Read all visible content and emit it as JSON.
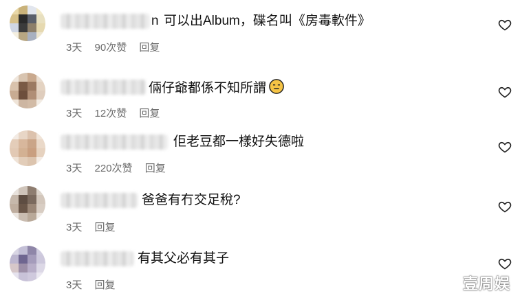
{
  "comments": [
    {
      "name_visible_fragment": "n",
      "text": "可以出Album，碟名叫《房毒軟件》",
      "time": "3天",
      "likes": "90次赞",
      "reply": "回复",
      "avatar_colors": [
        "#e9d8a8",
        "#c9b27a",
        "#e2e6ee",
        "#f2e9c8",
        "#d6c089",
        "#2a2a2a",
        "#5a5f6a",
        "#e8e0c0",
        "#cfd6e4",
        "#3b3b3b",
        "#8d7f6a",
        "#e6d9b0",
        "#f4efe0",
        "#b7a682",
        "#a8b0c0",
        "#eee6d0"
      ]
    },
    {
      "text": "倆仔爺都係不知所謂",
      "time": "3天",
      "likes": "12次赞",
      "reply": "回复",
      "avatar_colors": [
        "#efe6dc",
        "#d8c4b0",
        "#c9a98e",
        "#e9ddd0",
        "#d9c2ac",
        "#7a5a45",
        "#9c7a62",
        "#e4d3c2",
        "#c8ab92",
        "#6d4e3c",
        "#b08e76",
        "#dfcdbd",
        "#efe4d8",
        "#cdb6a2",
        "#d2bba6",
        "#f2ebe3"
      ]
    },
    {
      "text": "佢老豆都一樣好失德啦",
      "time": "3天",
      "likes": "220次赞",
      "reply": "回复",
      "avatar_colors": [
        "#f3ebe4",
        "#e8d6c6",
        "#dcc2ad",
        "#f0e4d8",
        "#e4cdb9",
        "#d8b79c",
        "#caa588",
        "#ead9c9",
        "#e2c9b4",
        "#d3b193",
        "#c99f80",
        "#e6d2bf",
        "#efe3d7",
        "#e2cdb9",
        "#dcc4ae",
        "#f4ece5"
      ]
    },
    {
      "text": "爸爸有冇交足稅?",
      "time": "3天",
      "likes": "",
      "reply": "回复",
      "avatar_colors": [
        "#e8e2dc",
        "#cfc4ba",
        "#8e7d70",
        "#ddd5cc",
        "#c6b8ab",
        "#5e4d42",
        "#7b6a5e",
        "#d3c7bc",
        "#bfae9f",
        "#6a5648",
        "#9a8676",
        "#d8cdc3",
        "#ebe5df",
        "#c9bcb0",
        "#b9a999",
        "#efeae5"
      ]
    },
    {
      "text": "有其父必有其子",
      "time": "3天",
      "likes": "",
      "reply": "回复",
      "avatar_colors": [
        "#d9d6e4",
        "#c3bfd6",
        "#8f86a8",
        "#d0ccdf",
        "#bcb6cf",
        "#6f6690",
        "#a59cbb",
        "#cdc8dc",
        "#d6c7c9",
        "#9d8fa8",
        "#b8aec8",
        "#dcd8e6",
        "#e6e3ee",
        "#c8c2d8",
        "#cfc9dd",
        "#ebe8f1"
      ]
    }
  ],
  "watermark": "壹周娱",
  "icons": {
    "like": "heart-outline-icon",
    "emoji": "expressionless-face-icon"
  }
}
